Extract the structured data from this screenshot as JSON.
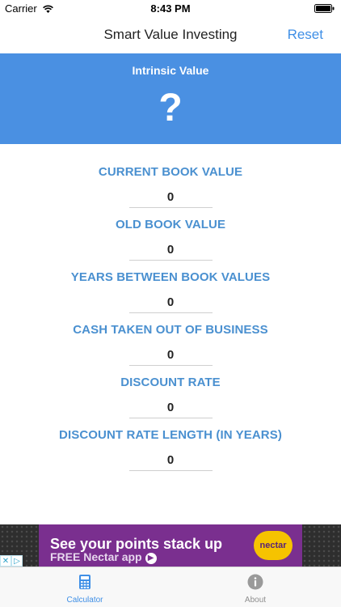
{
  "status_bar": {
    "carrier": "Carrier",
    "time": "8:43 PM"
  },
  "nav": {
    "title": "Smart Value Investing",
    "reset_label": "Reset"
  },
  "result": {
    "label": "Intrinsic Value",
    "value": "?"
  },
  "fields": [
    {
      "label": "CURRENT BOOK VALUE",
      "value": "0"
    },
    {
      "label": "OLD BOOK VALUE",
      "value": "0"
    },
    {
      "label": "YEARS BETWEEN BOOK VALUES",
      "value": "0"
    },
    {
      "label": "CASH TAKEN OUT OF BUSINESS",
      "value": "0"
    },
    {
      "label": "DISCOUNT RATE",
      "value": "0"
    },
    {
      "label": "DISCOUNT RATE LENGTH (IN YEARS)",
      "value": "0"
    }
  ],
  "ad": {
    "headline": "See your points stack up",
    "subline": "FREE Nectar app",
    "brand": "nectar",
    "adchoices_label": "AdChoices"
  },
  "tabs": [
    {
      "label": "Calculator",
      "icon": "calculator-icon",
      "active": true
    },
    {
      "label": "About",
      "icon": "info-icon",
      "active": false
    }
  ],
  "colors": {
    "accent": "#4a90e2",
    "label_blue": "#4a90d0",
    "ad_purple": "#7a2f8f",
    "nectar_yellow": "#f6c300"
  }
}
